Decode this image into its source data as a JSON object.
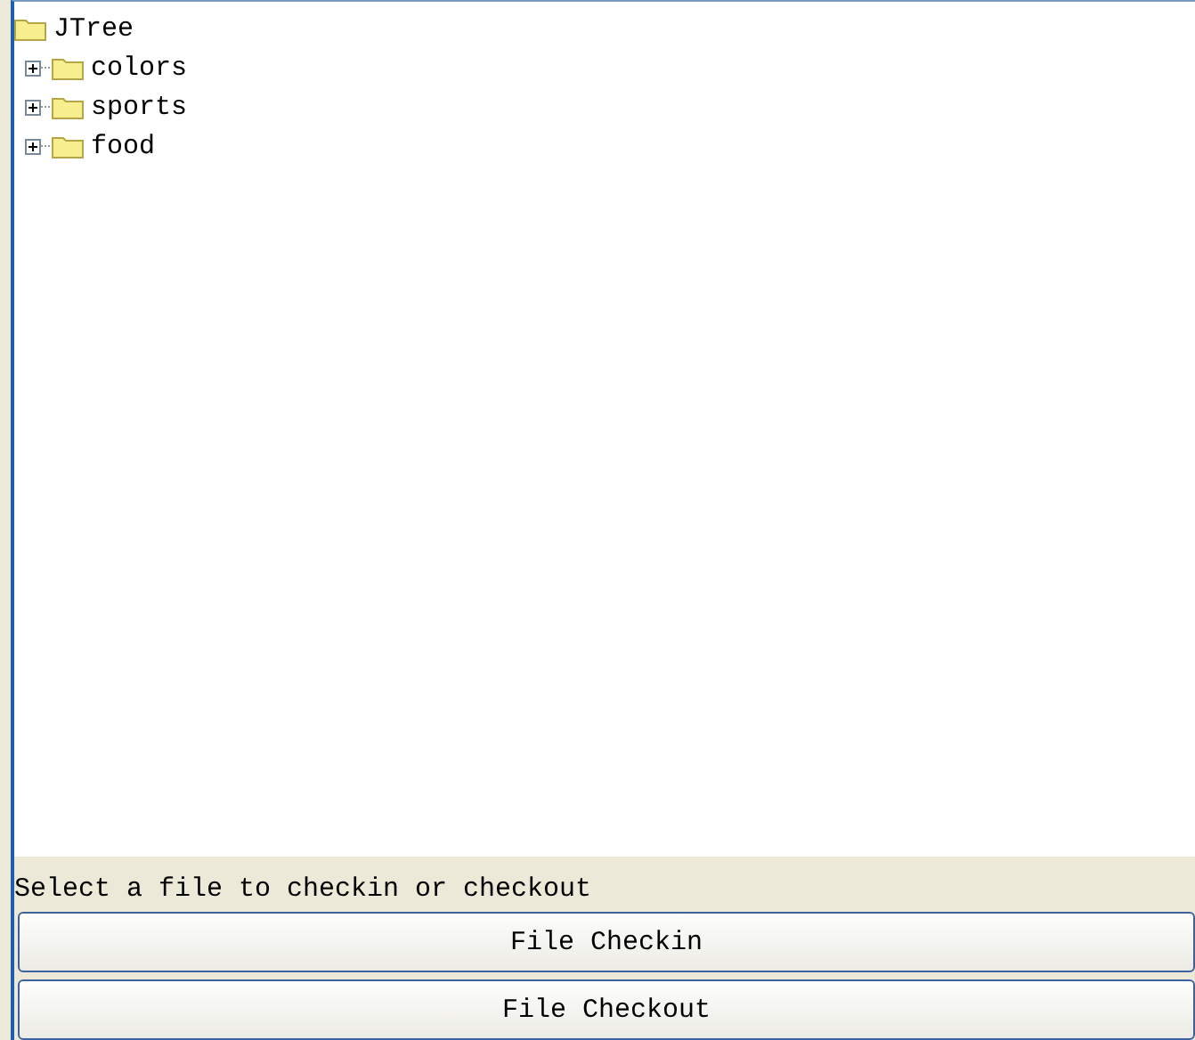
{
  "tree": {
    "label": "JTree",
    "children": [
      {
        "label": "colors",
        "expanded": false
      },
      {
        "label": "sports",
        "expanded": false
      },
      {
        "label": "food",
        "expanded": false
      }
    ]
  },
  "status_label": "Select a file to checkin or checkout",
  "buttons": [
    "File Checkin",
    "File Checkout"
  ]
}
